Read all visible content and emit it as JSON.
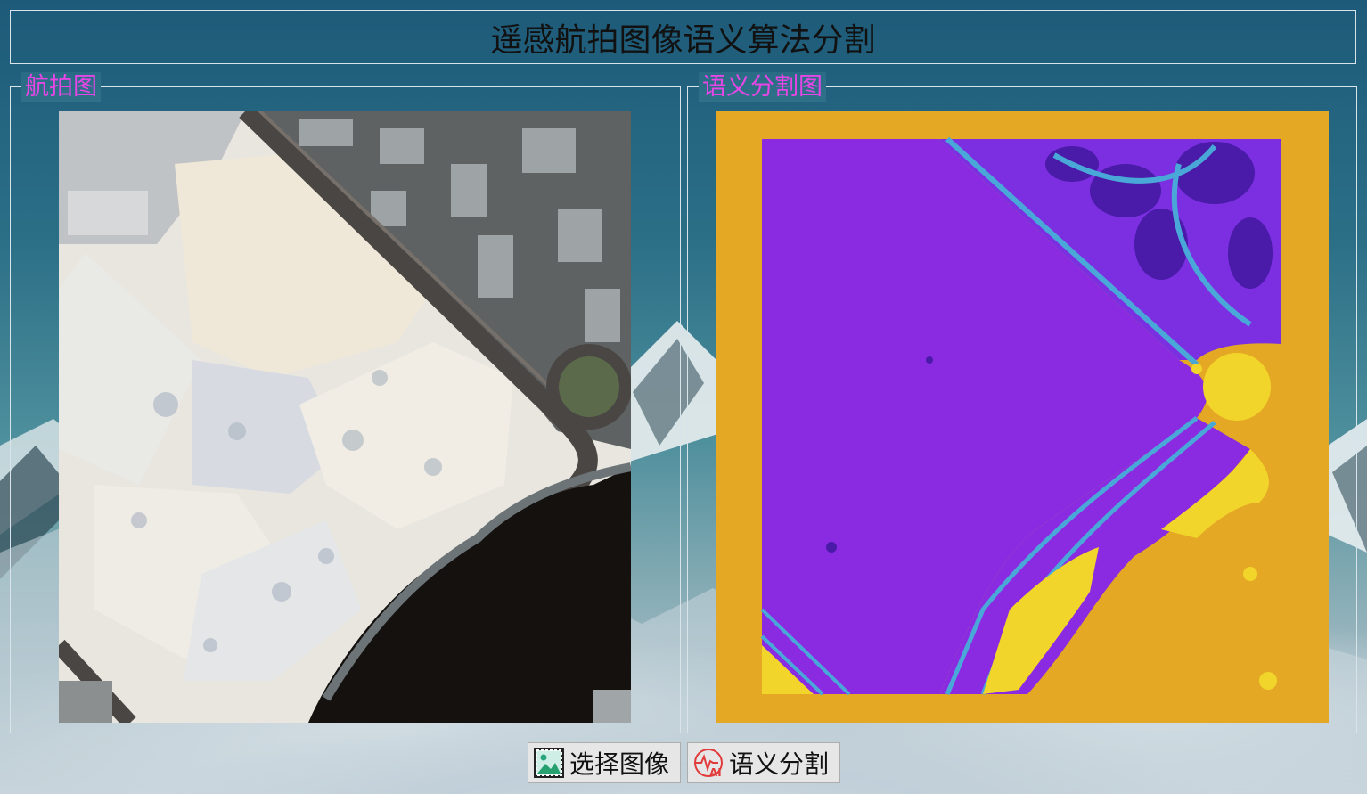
{
  "window": {
    "title": "遥感航拍图像语义算法分割"
  },
  "panels": {
    "left": {
      "label": "航拍图"
    },
    "right": {
      "label": "语义分割图"
    }
  },
  "buttons": {
    "select_image": {
      "label": "选择图像",
      "icon": "image-icon"
    },
    "segment": {
      "label": "语义分割",
      "icon": "ai-pulse-icon"
    }
  },
  "colors": {
    "panel_label": "#e646e6",
    "seg_background": "#e4a825",
    "seg_building": "#8a2be2",
    "seg_road": "#4aa8d8",
    "seg_vegetation": "#f2d52a",
    "seg_dark": "#3c1a9a"
  }
}
